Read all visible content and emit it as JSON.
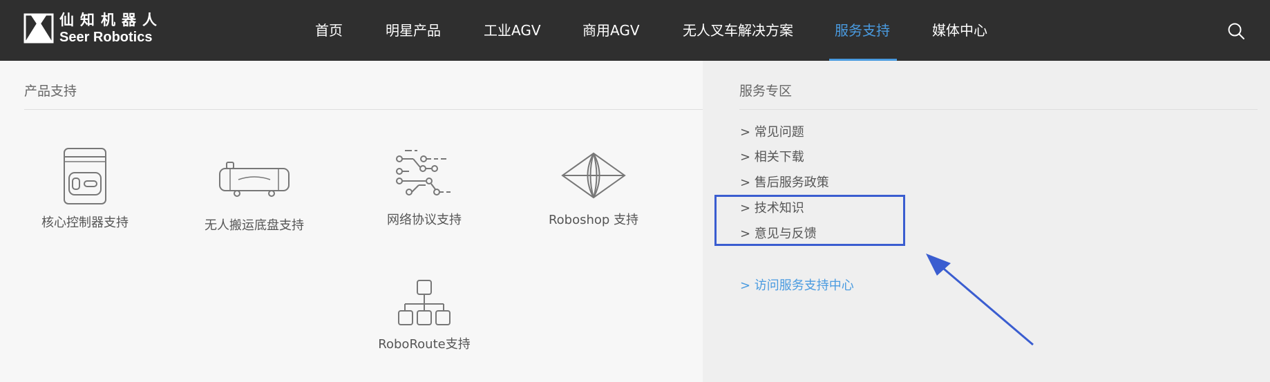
{
  "brand": {
    "name_cn": "仙知机器人",
    "name_en": "Seer Robotics",
    "logo_icon": "seer-logo-icon"
  },
  "nav": {
    "items": [
      {
        "label": "首页"
      },
      {
        "label": "明星产品"
      },
      {
        "label": "工业AGV"
      },
      {
        "label": "商用AGV"
      },
      {
        "label": "无人叉车解决方案"
      },
      {
        "label": "服务支持",
        "active": true
      },
      {
        "label": "媒体中心"
      }
    ],
    "search_icon": "search-icon",
    "active_color": "#4a9be0"
  },
  "product_support": {
    "title": "产品支持",
    "items": [
      {
        "label": "核心控制器支持",
        "icon": "controller-icon"
      },
      {
        "label": "无人搬运底盘支持",
        "icon": "chassis-icon"
      },
      {
        "label": "网络协议支持",
        "icon": "network-protocol-icon"
      },
      {
        "label": "Roboshop 支持",
        "icon": "roboshop-icon"
      },
      {
        "label": "RoboRoute支持",
        "icon": "roboroute-icon"
      }
    ]
  },
  "service_zone": {
    "title": "服务专区",
    "links": [
      {
        "label": "> 常见问题"
      },
      {
        "label": "> 相关下载"
      },
      {
        "label": "> 售后服务政策"
      },
      {
        "label": "> 技术知识"
      },
      {
        "label": "> 意见与反馈"
      }
    ],
    "center_link": "> 访问服务支持中心"
  },
  "annotation": {
    "highlight_color": "#3a5dd0"
  }
}
